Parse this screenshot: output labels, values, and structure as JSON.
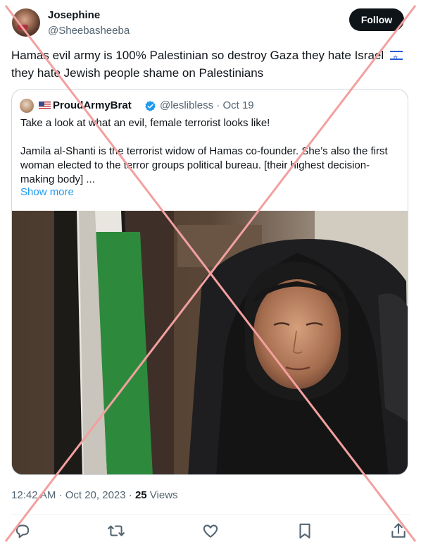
{
  "author": {
    "name": "Josephine",
    "handle": "@Sheebasheeba",
    "follow_label": "Follow"
  },
  "tweet": {
    "text": "Hamas evil army is 100% Palestinian so destroy Gaza they hate Israel",
    "text_tail": "they hate Jewish people shame on Palestinians",
    "flag_icon": "israel-flag-emoji"
  },
  "quoted": {
    "name": "ProudArmyBrat",
    "handle": "@leslibless",
    "date": "Oct 19",
    "flag_icon": "us-flag-emoji",
    "paragraph1": "Take a look at what an evil, female terrorist looks like!",
    "paragraph2": "Jamila al-Shanti is the terrorist widow of Hamas co-founder. She’s also the first woman elected to the terror groups political bureau. [their highest decision-making body] ...",
    "show_more": "Show more"
  },
  "meta": {
    "time": "12:42 AM · Oct 20, 2023 ·",
    "views_count": "25",
    "views_label": "Views"
  },
  "actions": [
    "reply-icon",
    "retweet-icon",
    "like-icon",
    "bookmark-icon",
    "share-icon"
  ],
  "colors": {
    "text": "#0f1419",
    "secondary": "#536471",
    "link": "#1d9bf0",
    "verified": "#1d9bf0",
    "overlay_cross": "#f2a0a0"
  }
}
